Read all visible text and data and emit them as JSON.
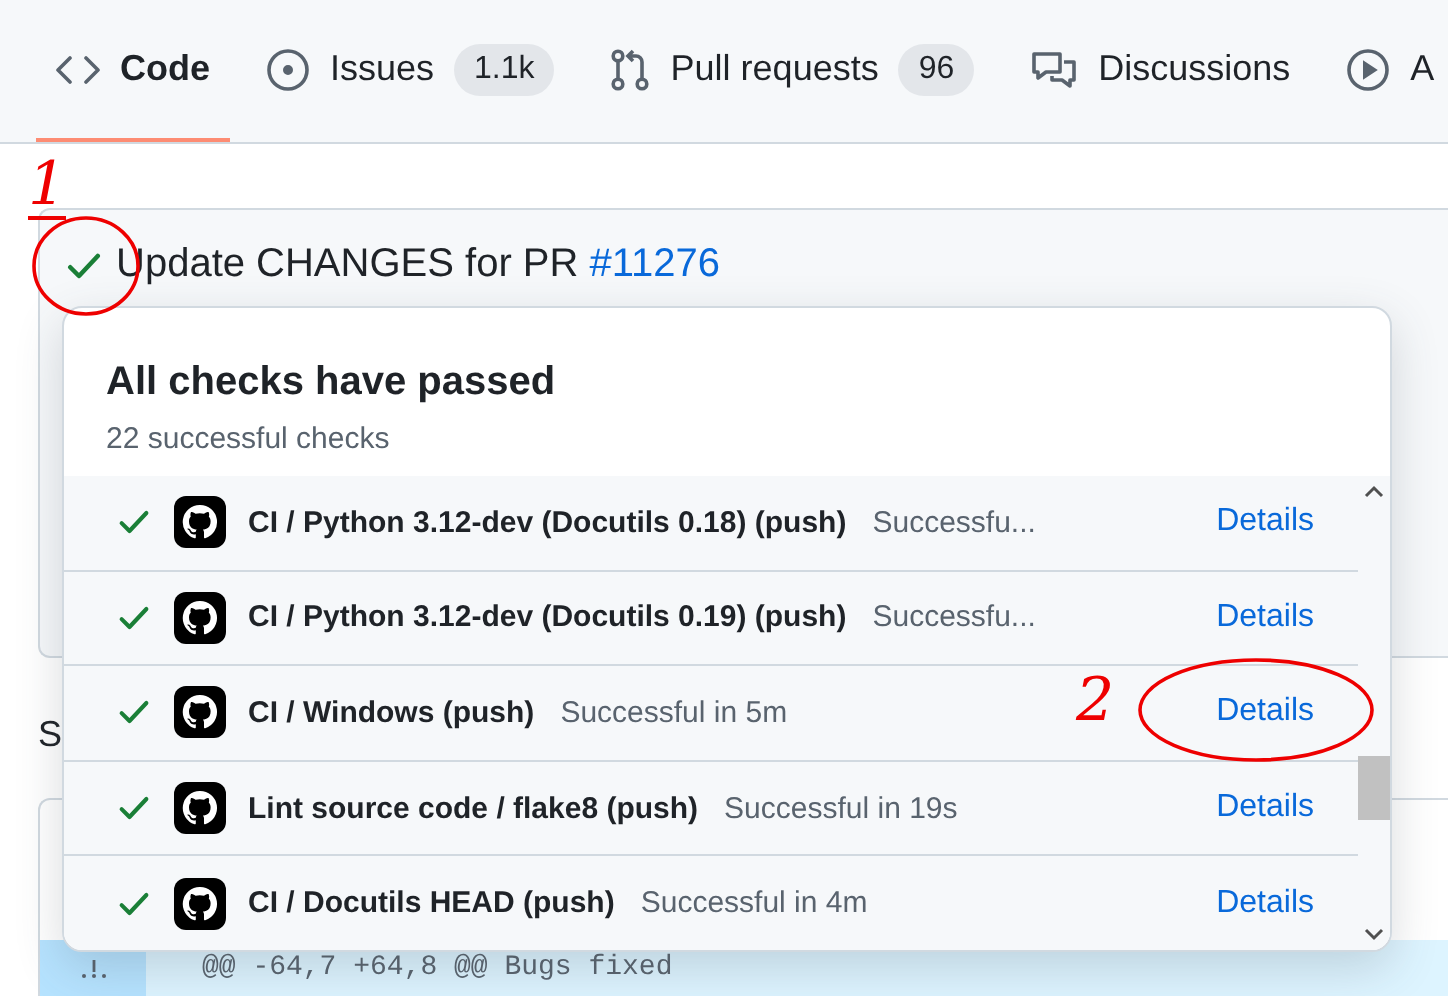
{
  "tabs": [
    {
      "label": "Code",
      "selected": true
    },
    {
      "label": "Issues",
      "count": "1.1k",
      "selected": false
    },
    {
      "label": "Pull requests",
      "count": "96",
      "selected": false
    },
    {
      "label": "Discussions",
      "selected": false
    },
    {
      "label": "A",
      "selected": false
    }
  ],
  "commit": {
    "title": "Update CHANGES for PR ",
    "pr_link": "#11276"
  },
  "page_text": "S",
  "diff": {
    "hunk": "@@ -64,7 +64,8 @@ Bugs fixed"
  },
  "checks_popup": {
    "title": "All checks have passed",
    "summary": "22 successful checks",
    "checks": [
      {
        "name": "CI / Python 3.12-dev (Docutils 0.18) (push)",
        "status_text": "Successfu...",
        "link": "Details"
      },
      {
        "name": "CI / Python 3.12-dev (Docutils 0.19) (push)",
        "status_text": "Successfu...",
        "link": "Details"
      },
      {
        "name": "CI / Windows (push)",
        "status_text": "Successful in 5m",
        "link": "Details"
      },
      {
        "name": "Lint source code / flake8 (push)",
        "status_text": "Successful in 19s",
        "link": "Details"
      },
      {
        "name": "CI / Docutils HEAD (push)",
        "status_text": "Successful in 4m",
        "link": "Details"
      }
    ]
  },
  "annotations": [
    {
      "label": "1"
    },
    {
      "label": "2"
    }
  ]
}
